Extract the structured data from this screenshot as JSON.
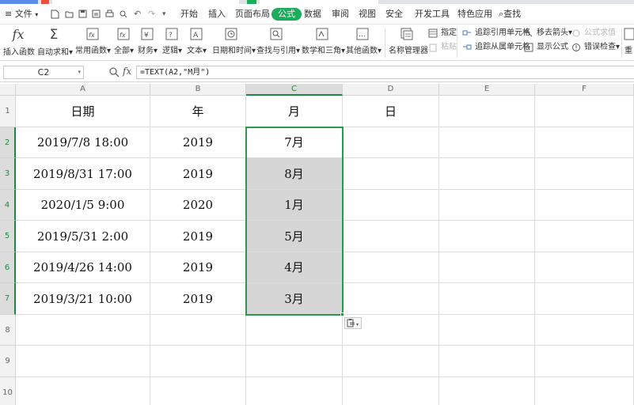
{
  "app": {
    "menu": {
      "file_label": "文件",
      "tabs": [
        "开始",
        "插入",
        "页面布局",
        "公式",
        "数据",
        "审阅",
        "视图",
        "安全",
        "开发工具",
        "特色应用"
      ],
      "active_tab": "公式",
      "search_label": "查找",
      "accent": "#1aad5a"
    },
    "ribbon": {
      "buttons": [
        "插入函数",
        "自动求和",
        "常用函数",
        "全部",
        "财务",
        "逻辑",
        "文本",
        "日期和时间",
        "查找与引用",
        "数学和三角",
        "其他函数",
        "名称管理器"
      ],
      "small": {
        "specify": "指定",
        "paste": "粘贴",
        "trace_precedents": "追踪引用单元格",
        "trace_dependents": "追踪从属单元格",
        "remove_arrows": "移去箭头",
        "show_formulas": "显示公式",
        "eval_formula": "公式求值",
        "error_check": "错误检查",
        "recalc": "重"
      }
    },
    "formula_bar": {
      "name_box": "C2",
      "fx": "fx",
      "formula": "=TEXT(A2,\"M月\")"
    }
  },
  "sheet": {
    "columns": [
      "A",
      "B",
      "C",
      "D",
      "E",
      "F"
    ],
    "rows": [
      "1",
      "2",
      "3",
      "4",
      "5",
      "6",
      "7",
      "8",
      "9",
      "10"
    ],
    "header": [
      "日期",
      "年",
      "月",
      "日"
    ],
    "data": [
      [
        "2019/7/8 18:00",
        "2019",
        "7月"
      ],
      [
        "2019/8/31 17:00",
        "2019",
        "8月"
      ],
      [
        "2020/1/5 9:00",
        "2020",
        "1月"
      ],
      [
        "2019/5/31 2:00",
        "2019",
        "5月"
      ],
      [
        "2019/4/26 14:00",
        "2019",
        "4月"
      ],
      [
        "2019/3/21 10:00",
        "2019",
        "3月"
      ]
    ],
    "active_cell": "C2",
    "selection": "C2:C7",
    "selection_color": "#2a9a4a"
  }
}
